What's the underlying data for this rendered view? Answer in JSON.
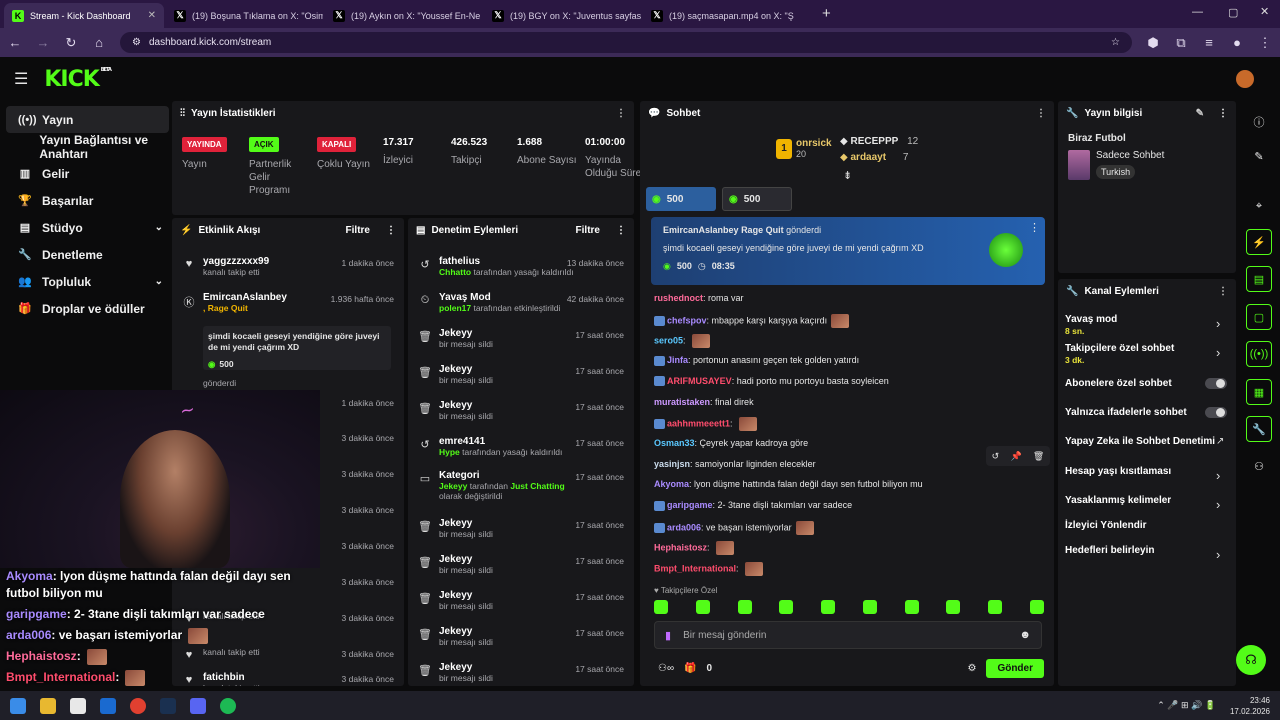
{
  "browser": {
    "tabs": [
      {
        "title": "Stream - Kick Dashboard",
        "fav": "K",
        "favbg": "#53fc18"
      },
      {
        "title": "(19) Boşuna Tıklama on X: \"Osim",
        "fav": "𝕏",
        "favbg": "#000"
      },
      {
        "title": "(19) Aykın on X: \"Youssef En-Ne",
        "fav": "𝕏",
        "favbg": "#000"
      },
      {
        "title": "(19) BGY on X: \"Juventus sayfas",
        "fav": "𝕏",
        "favbg": "#000"
      },
      {
        "title": "(19) saçmasapan.mp4 on X: \"Ş",
        "fav": "𝕏",
        "favbg": "#000"
      }
    ],
    "url": "dashboard.kick.com/stream"
  },
  "brand": {
    "logo": "KICK",
    "beta": "BETA"
  },
  "nav": [
    {
      "label": "Yayın",
      "icon": "((•))",
      "active": true
    },
    {
      "label": "Yayın Bağlantısı ve Anahtarı",
      "icon": ""
    },
    {
      "label": "Gelir",
      "icon": "▥"
    },
    {
      "label": "Başarılar",
      "icon": "🏆"
    },
    {
      "label": "Stüdyo",
      "icon": "▤",
      "chev": true
    },
    {
      "label": "Denetleme",
      "icon": "🔧"
    },
    {
      "label": "Topluluk",
      "icon": "👥",
      "chev": true
    },
    {
      "label": "Droplar ve ödüller",
      "icon": "🎁"
    }
  ],
  "stats": {
    "title": "Yayın İstatistikleri",
    "items": [
      {
        "badge": "YAYINDA",
        "badgecolor": "#e0223a",
        "label": "Yayın"
      },
      {
        "badge": "AÇIK",
        "badgecolor": "#53fc18",
        "label": "Partnerlik Gelir Programı"
      },
      {
        "badge": "KAPALI",
        "badgecolor": "#e0223a",
        "label": "Çoklu Yayın"
      },
      {
        "value": "17.317",
        "label": "İzleyici"
      },
      {
        "value": "426.523",
        "label": "Takipçi"
      },
      {
        "value": "1.688",
        "label": "Abone Sayısı"
      },
      {
        "value": "01:00:00",
        "label": "Yayında Olduğu Süre"
      }
    ]
  },
  "activity": {
    "title": "Etkinlik Akışı",
    "filter": "Filtre",
    "rows": [
      {
        "name": "yaggzzzxxx99",
        "sub": "kanalı takip etti",
        "time": "1 dakika önce"
      },
      {
        "name": "EmircanAslanbey",
        "sub": ", Rage Quit",
        "time": "1.936 hafta önce",
        "msg": "şimdi kocaeli geseyi yendiğine göre juveyi de mi yendi çağrım XD",
        "amount": "500",
        "sub2": "gönderdi"
      },
      {
        "time": "1 dakika önce"
      },
      {
        "time": "3 dakika önce"
      },
      {
        "time": "3 dakika önce"
      },
      {
        "time": "3 dakika önce"
      },
      {
        "time": "3 dakika önce"
      },
      {
        "time": "3 dakika önce"
      },
      {
        "sub": "kanalı takip etti",
        "time": "3 dakika önce"
      },
      {
        "sub": "kanalı takip etti",
        "time": "3 dakika önce"
      },
      {
        "name": "fatichbin",
        "sub": "kanalı takip etti",
        "time": "3 dakika önce"
      }
    ]
  },
  "moderation": {
    "title": "Denetim Eylemleri",
    "filter": "Filtre",
    "rows": [
      {
        "icon": "↺",
        "name": "fathelius",
        "hl": "Chhatto",
        "sub": " tarafından yasağı kaldırıldı",
        "time": "13 dakika önce"
      },
      {
        "icon": "⏲",
        "name": "Yavaş Mod",
        "hl": "polen17",
        "sub": " tarafından etkinleştirildi",
        "time": "42 dakika önce"
      },
      {
        "icon": "🗑",
        "name": "Jekeyy",
        "sub": "bir mesajı sildi",
        "time": "17 saat önce"
      },
      {
        "icon": "🗑",
        "name": "Jekeyy",
        "sub": "bir mesajı sildi",
        "time": "17 saat önce"
      },
      {
        "icon": "🗑",
        "name": "Jekeyy",
        "sub": "bir mesajı sildi",
        "time": "17 saat önce"
      },
      {
        "icon": "↺",
        "name": "emre4141",
        "hl": "Hype",
        "sub": " tarafından yasağı kaldırıldı",
        "time": "17 saat önce"
      },
      {
        "icon": "▭",
        "name": "Kategori",
        "hl": "Jekeyy",
        "sub": " tarafından ",
        "hl2": "Just Chatting",
        "sub2": " olarak değiştirildi",
        "time": "17 saat önce"
      },
      {
        "icon": "🗑",
        "name": "Jekeyy",
        "sub": "bir mesajı sildi",
        "time": "17 saat önce"
      },
      {
        "icon": "🗑",
        "name": "Jekeyy",
        "sub": "bir mesajı sildi",
        "time": "17 saat önce"
      },
      {
        "icon": "🗑",
        "name": "Jekeyy",
        "sub": "bir mesajı sildi",
        "time": "17 saat önce"
      },
      {
        "icon": "🗑",
        "name": "Jekeyy",
        "sub": "bir mesajı sildi",
        "time": "17 saat önce"
      },
      {
        "icon": "🗑",
        "name": "Jekeyy",
        "sub": "bir mesajı sildi",
        "time": "17 saat önce"
      }
    ]
  },
  "chat": {
    "title": "Sohbet",
    "top": [
      {
        "name": "onrsick",
        "rank": "1",
        "count": "20"
      },
      {
        "name": "RECEPPP",
        "count": "12"
      },
      {
        "name": "ardaayt",
        "count": "7"
      }
    ],
    "pins": [
      "500",
      "500"
    ],
    "pinned": {
      "user": "EmircanAslanbey",
      "action": "Rage Quit",
      "suffix": "gönderdi",
      "msg": "şimdi kocaeli geseyi yendiğine göre juveyi de mi yendi çağrım XD",
      "amount": "500",
      "time": "08:35"
    },
    "messages": [
      {
        "u": "rushednoct",
        "c": "#ff6b9a",
        "t": "roma var"
      },
      {
        "u": "chefspov",
        "c": "#a98bff",
        "t": "mbappe karşı karşıya kaçırdı",
        "emote": true,
        "badge": true
      },
      {
        "u": "sero05",
        "c": "#5ac8ff",
        "t": "",
        "emote": true
      },
      {
        "u": "Jinfa",
        "c": "#a98bff",
        "t": "portonun anasını geçen tek golden yatırdı",
        "badge": true
      },
      {
        "u": "ARIFMUSAYEV",
        "c": "#ff4d6d",
        "t": "hadi porto mu portoyu basta soyleicen",
        "badge": true
      },
      {
        "u": "muratistaken",
        "c": "#c9f",
        "t": "final direk"
      },
      {
        "u": "aahhmmeeett1",
        "c": "#ff4d6d",
        "t": "",
        "emote": true,
        "badge": true
      },
      {
        "u": "Osman33",
        "c": "#5ac8ff",
        "t": "Çeyrek yapar kadroya göre"
      },
      {
        "u": "yasinjsn",
        "c": "#cde",
        "t": "samoiyonlar liginden elecekler"
      },
      {
        "u": "Akyoma",
        "c": "#a98bff",
        "t": "lyon düşme hattında falan değil dayı sen futbol biliyon mu"
      },
      {
        "u": "garipgame",
        "c": "#a98bff",
        "t": "2- 3tane dişli takımları var sadece",
        "badge": true
      },
      {
        "u": "arda006",
        "c": "#a98bff",
        "t": "ve başarı istemiyorlar",
        "emote": true,
        "badge": true
      },
      {
        "u": "Hephaistosz",
        "c": "#ff6b9a",
        "t": "",
        "emote": true
      },
      {
        "u": "Bmpt_International",
        "c": "#ff4d6d",
        "t": "",
        "emote": true
      }
    ],
    "followers_only": "Takipçilere Özel",
    "placeholder": "Bir mesaj gönderin",
    "bottom_count": "0",
    "send": "Gönder"
  },
  "streaminfo": {
    "title": "Yayın bilgisi",
    "name": "Biraz Futbol",
    "category": "Sadece Sohbet",
    "lang": "Turkish"
  },
  "channel_actions": {
    "title": "Kanal Eylemleri",
    "items": [
      {
        "label": "Yavaş mod",
        "sub": "8 sn.",
        "type": "chev"
      },
      {
        "label": "Takipçilere özel sohbet",
        "sub": "3 dk.",
        "type": "chev"
      },
      {
        "label": "Abonelere özel sohbet",
        "type": "toggle"
      },
      {
        "label": "Yalnızca ifadelerle sohbet",
        "type": "toggle"
      },
      {
        "label": "Yapay Zeka ile Sohbet Denetimi",
        "type": "ext"
      },
      {
        "label": "Hesap yaşı kısıtlaması",
        "type": "chev"
      },
      {
        "label": "Yasaklanmış kelimeler",
        "type": "chev"
      },
      {
        "label": "İzleyici Yönlendir",
        "type": "none"
      },
      {
        "label": "Hedefleri belirleyin",
        "type": "chev"
      }
    ]
  },
  "overlay": [
    {
      "u": "Akyoma",
      "t": ": lyon düşme hattında falan değil dayı sen futbol biliyon mu",
      "c": "#a98bff"
    },
    {
      "u": "garipgame",
      "t": ": 2- 3tane dişli takımları var sadece",
      "c": "#a98bff"
    },
    {
      "u": "arda006",
      "t": ": ve başarı istemiyorlar",
      "c": "#a98bff"
    },
    {
      "u": "Hephaistosz",
      "t": ":",
      "c": "#ff6b9a"
    },
    {
      "u": "Bmpt_International",
      "t": ":",
      "c": "#ff4d6d"
    }
  ],
  "taskbar": {
    "time": "23:46",
    "date": "17.02.2026"
  },
  "colors": {
    "accent": "#53fc18",
    "live": "#e0223a"
  }
}
